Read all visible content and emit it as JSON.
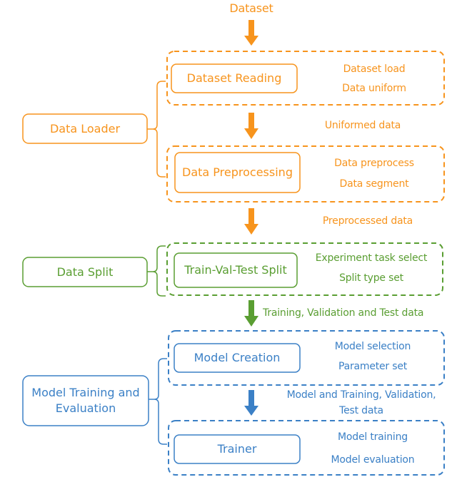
{
  "colors": {
    "orange": "#f7941d",
    "green": "#5a9e32",
    "blue": "#3b80c6"
  },
  "input_label": "Dataset",
  "stages": [
    {
      "name": "Data Loader",
      "color": "orange",
      "modules": [
        {
          "title": "Dataset Reading",
          "functions": [
            "Dataset load",
            "Data uniform"
          ]
        },
        {
          "title": "Data Preprocessing",
          "functions": [
            "Data preprocess",
            "Data segment"
          ]
        }
      ],
      "inner_flow_label": "Uniformed data",
      "output_label": "Preprocessed data"
    },
    {
      "name": "Data Split",
      "color": "green",
      "modules": [
        {
          "title": "Train-Val-Test Split",
          "functions": [
            "Experiment task select",
            "Split type set"
          ]
        }
      ],
      "output_label": "Training, Validation and Test data"
    },
    {
      "name": "Model Training and Evaluation",
      "color": "blue",
      "modules": [
        {
          "title": "Model Creation",
          "functions": [
            "Model selection",
            "Parameter set"
          ]
        },
        {
          "title": "Trainer",
          "functions": [
            "Model training",
            "Model evaluation"
          ]
        }
      ],
      "inner_flow_label_line1": "Model and Training, Validation,",
      "inner_flow_label_line2": "Test data"
    }
  ]
}
